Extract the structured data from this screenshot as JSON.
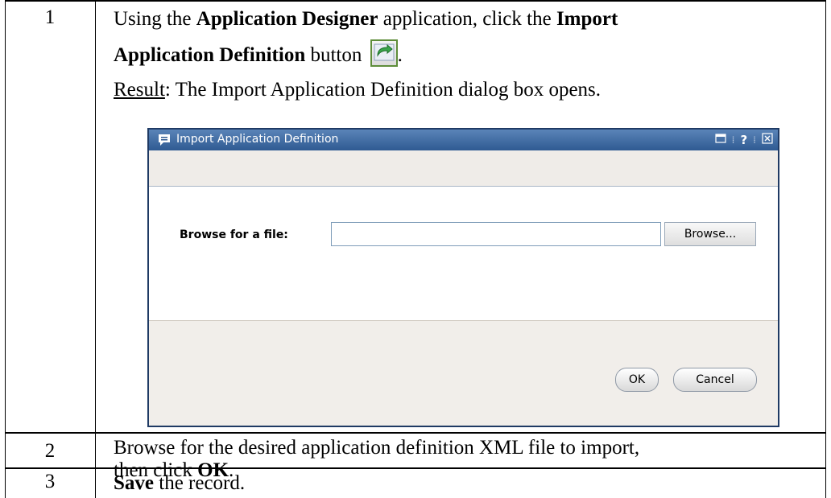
{
  "steps": [
    {
      "number": "1",
      "line1": {
        "a": "Using the ",
        "b": "Application Designer",
        "c": " application, click the ",
        "d": "Import"
      },
      "line2": {
        "a": "Application Definition",
        "b": " button "
      },
      "button_icon": "import-arrow-icon",
      "line2_end": ".",
      "result_label": "Result",
      "result_text": ": The Import Application Definition dialog box opens."
    },
    {
      "number": "2",
      "line1": "Browse for the desired application definition XML file to import,",
      "line2_a": "then click ",
      "line2_b": "OK",
      "line2_c": "."
    },
    {
      "number": "3",
      "bold": "Save",
      "rest": " the record."
    }
  ],
  "dialog": {
    "title": "Import Application Definition",
    "title_icon": "speech-bubble-icon",
    "controls": [
      "maximize-icon",
      "help-icon",
      "close-icon"
    ],
    "help_glyph": "?",
    "field_label": "Browse for a file:",
    "file_value": "",
    "browse_label": "Browse...",
    "ok_label": "OK",
    "cancel_label": "Cancel"
  },
  "colors": {
    "titlebar": "#2f5a92",
    "icon_border": "#5e8d3a"
  }
}
